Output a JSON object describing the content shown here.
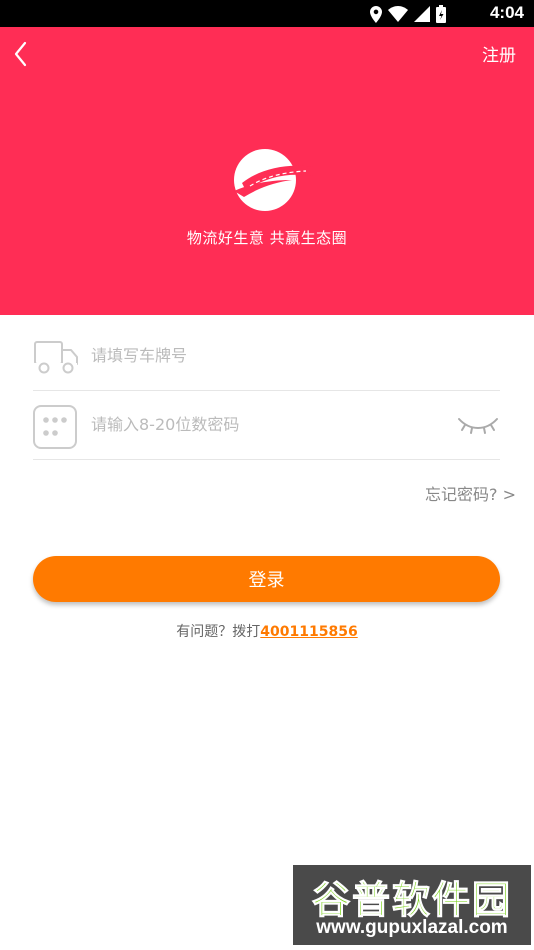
{
  "status_bar": {
    "time": "4:04"
  },
  "header": {
    "register_label": "注册",
    "slogan": "物流好生意 共赢生态圈",
    "background_color": "#ff2d55"
  },
  "form": {
    "plate_placeholder": "请填写车牌号",
    "password_placeholder": "请输入8-20位数密码",
    "forgot_label": "忘记密码? >",
    "login_label": "登录",
    "login_color": "#ff7a00"
  },
  "help": {
    "prefix": "有问题？拨打",
    "phone": "4001115856"
  },
  "watermark": {
    "title": "谷普软件园",
    "url": "www.gupuxlazal.com"
  },
  "icons": {
    "back": "chevron-left-icon",
    "truck": "truck-icon",
    "keypad": "keypad-icon",
    "eye": "closed-eye-icon",
    "logo": "road-logo-icon"
  }
}
